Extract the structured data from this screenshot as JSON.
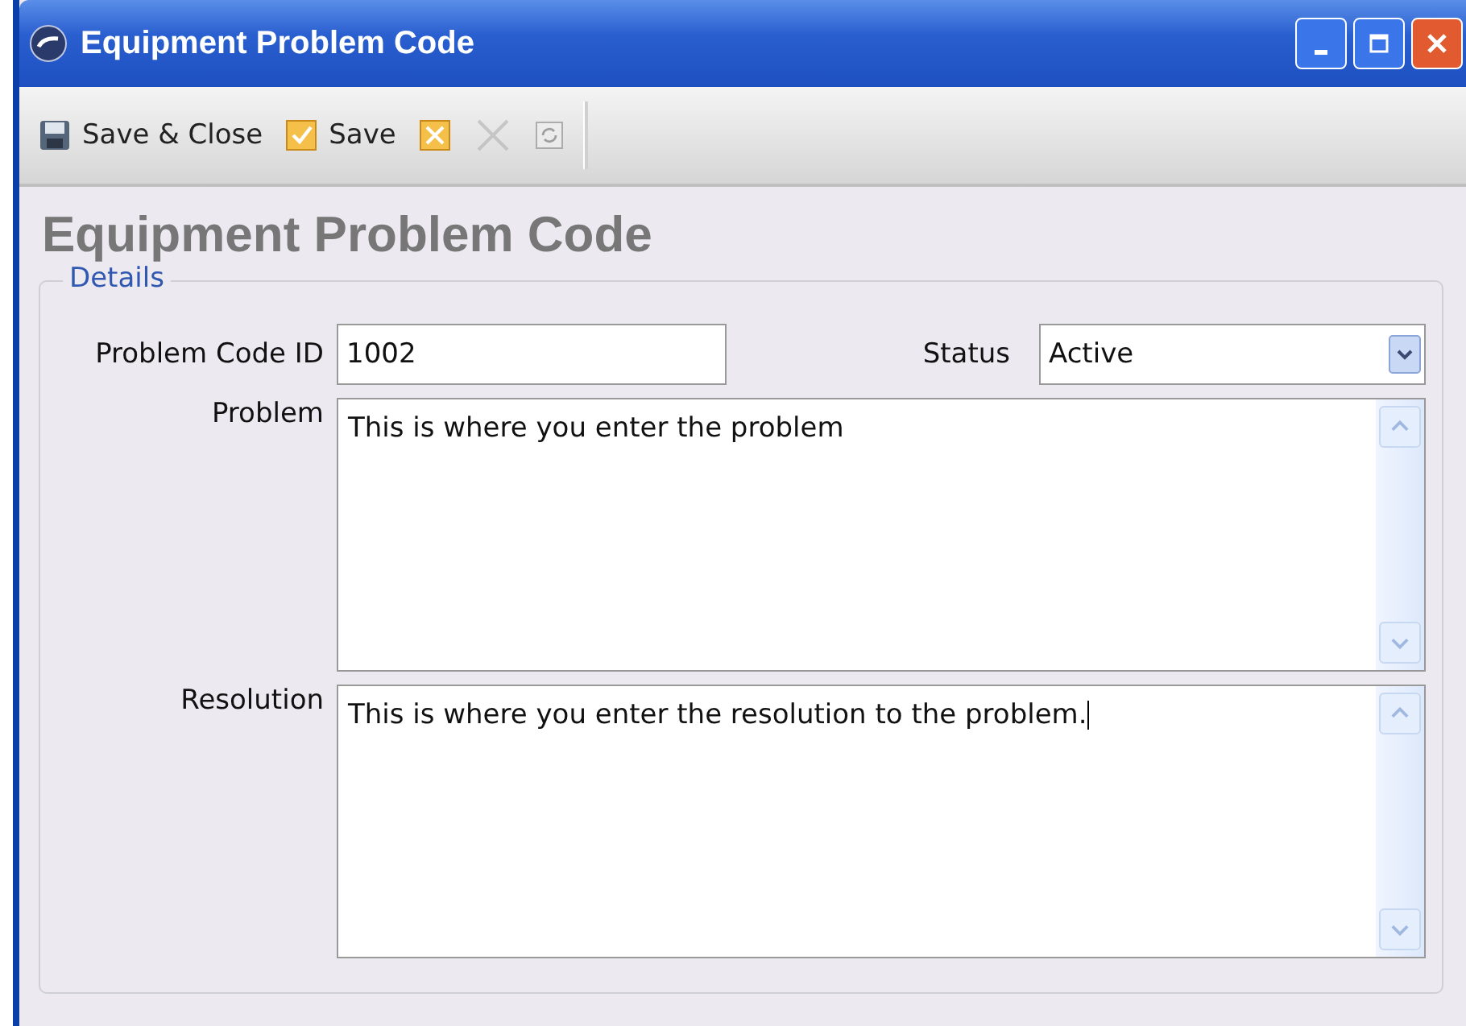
{
  "window": {
    "title": "Equipment Problem Code"
  },
  "toolbar": [
    {
      "kind": "save-close",
      "label": "Save & Close",
      "disabled": false
    },
    {
      "kind": "save",
      "label": "Save",
      "disabled": false
    },
    {
      "kind": "cancel",
      "disabled": false
    },
    {
      "kind": "delete",
      "disabled": true
    },
    {
      "kind": "refresh",
      "disabled": true
    }
  ],
  "heading": "Equipment Problem Code",
  "details": {
    "legend": "Details",
    "problem_code_id": {
      "label": "Problem Code ID",
      "value": "1002"
    },
    "status": {
      "label": "Status",
      "value": "Active"
    },
    "problem": {
      "label": "Problem",
      "value": "This is where you enter the problem"
    },
    "resolution": {
      "label": "Resolution",
      "value": "This is where you enter the resolution to the problem."
    }
  }
}
